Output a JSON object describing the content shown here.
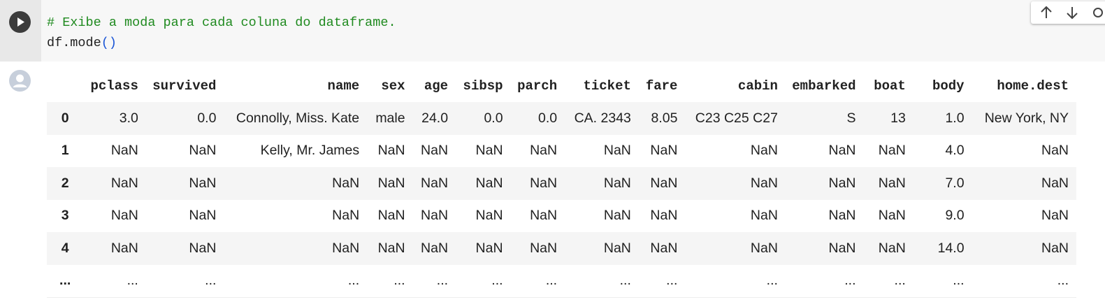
{
  "cell": {
    "comment": "# Exibe a moda para cada coluna do dataframe.",
    "code_prefix": "df.mode",
    "code_parens": "()"
  },
  "toolbar": {
    "move_up_icon": "arrow-up-icon",
    "move_down_icon": "arrow-down-icon"
  },
  "table": {
    "index_header": "",
    "columns": [
      "pclass",
      "survived",
      "name",
      "sex",
      "age",
      "sibsp",
      "parch",
      "ticket",
      "fare",
      "cabin",
      "embarked",
      "boat",
      "body",
      "home.dest"
    ],
    "rows": [
      {
        "index": "0",
        "cells": [
          "3.0",
          "0.0",
          "Connolly, Miss. Kate",
          "male",
          "24.0",
          "0.0",
          "0.0",
          "CA. 2343",
          "8.05",
          "C23 C25 C27",
          "S",
          "13",
          "1.0",
          "New York, NY"
        ]
      },
      {
        "index": "1",
        "cells": [
          "NaN",
          "NaN",
          "Kelly, Mr. James",
          "NaN",
          "NaN",
          "NaN",
          "NaN",
          "NaN",
          "NaN",
          "NaN",
          "NaN",
          "NaN",
          "4.0",
          "NaN"
        ]
      },
      {
        "index": "2",
        "cells": [
          "NaN",
          "NaN",
          "NaN",
          "NaN",
          "NaN",
          "NaN",
          "NaN",
          "NaN",
          "NaN",
          "NaN",
          "NaN",
          "NaN",
          "7.0",
          "NaN"
        ]
      },
      {
        "index": "3",
        "cells": [
          "NaN",
          "NaN",
          "NaN",
          "NaN",
          "NaN",
          "NaN",
          "NaN",
          "NaN",
          "NaN",
          "NaN",
          "NaN",
          "NaN",
          "9.0",
          "NaN"
        ]
      },
      {
        "index": "4",
        "cells": [
          "NaN",
          "NaN",
          "NaN",
          "NaN",
          "NaN",
          "NaN",
          "NaN",
          "NaN",
          "NaN",
          "NaN",
          "NaN",
          "NaN",
          "14.0",
          "NaN"
        ]
      },
      {
        "index": "...",
        "cells": [
          "...",
          "...",
          "...",
          "...",
          "...",
          "...",
          "...",
          "...",
          "...",
          "...",
          "...",
          "...",
          "...",
          "..."
        ]
      }
    ]
  }
}
